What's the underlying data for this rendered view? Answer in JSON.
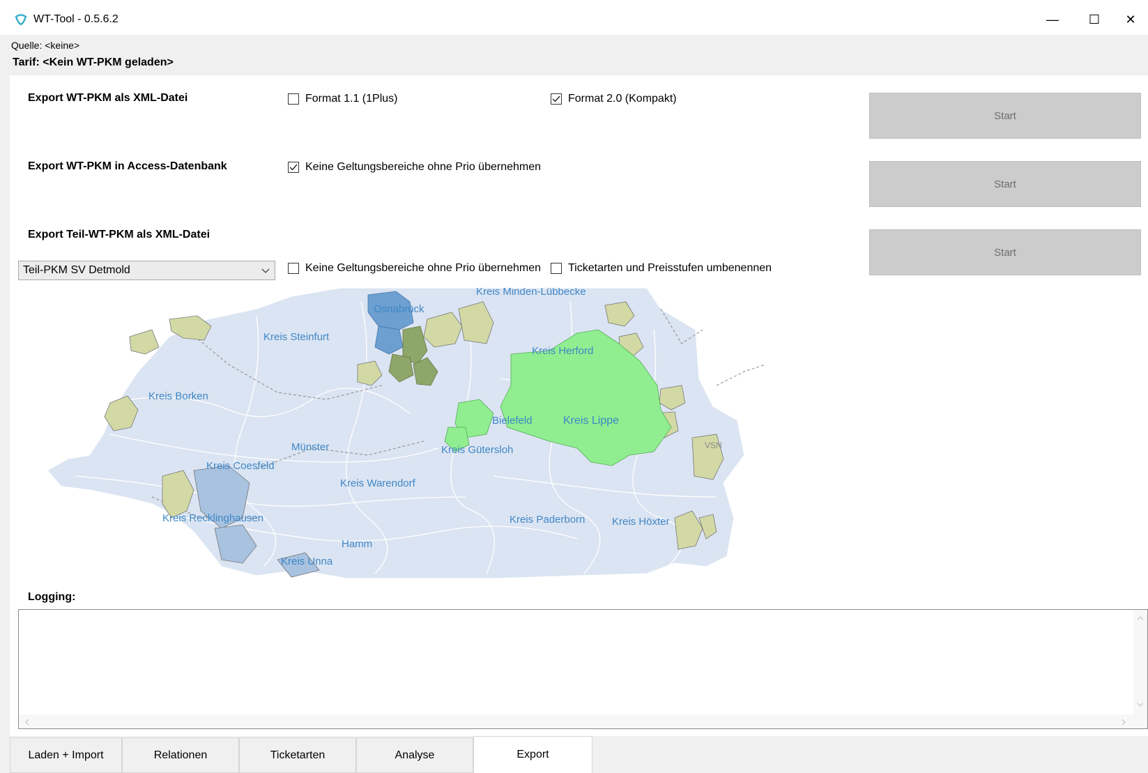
{
  "window": {
    "title": "WT-Tool - 0.5.6.2",
    "controls": {
      "minimize": "—",
      "maximize": "☐",
      "close": "✕"
    }
  },
  "info": {
    "source": "Quelle: <keine>",
    "tarif": "Tarif: <Kein WT-PKM geladen>"
  },
  "export_xml": {
    "title": "Export WT-PKM als XML-Datei",
    "format11": {
      "label": "Format 1.1 (1Plus)",
      "checked": false
    },
    "format20": {
      "label": "Format 2.0 (Kompakt)",
      "checked": true
    },
    "start": "Start"
  },
  "export_access": {
    "title": "Export WT-PKM in Access-Datenbank",
    "no_scopes": {
      "label": "Keine Geltungsbereiche ohne Prio übernehmen",
      "checked": true
    },
    "start": "Start"
  },
  "export_partial": {
    "title": "Export Teil-WT-PKM als XML-Datei",
    "selection": "Teil-PKM SV Detmold",
    "no_scopes": {
      "label": "Keine Geltungsbereiche ohne Prio übernehmen",
      "checked": false
    },
    "rename": {
      "label": "Ticketarten und Preisstufen umbenennen",
      "checked": false
    },
    "start": "Start"
  },
  "map": {
    "labels": {
      "kreis_minden": "Kreis Minden-Lübbecke",
      "osnabrueck": "Osnabrück",
      "kreis_steinfurt": "Kreis Steinfurt",
      "kreis_herford": "Kreis Herford",
      "kreis_borken": "Kreis Borken",
      "kreis_lippe": "Kreis Lippe",
      "bielefeld": "Bielefeld",
      "muenster": "Münster",
      "kreis_guetersloh": "Kreis Gütersloh",
      "kreis_coesfeld": "Kreis Coesfeld",
      "kreis_warendorf": "Kreis Warendorf",
      "kreis_recklinghausen": "Kreis Recklinghausen",
      "kreis_paderborn": "Kreis Paderborn",
      "kreis_hoexter": "Kreis Höxter",
      "hamm": "Hamm",
      "kreis_unna": "Kreis Unna",
      "vsn": "VSN"
    }
  },
  "logging": {
    "label": "Logging:"
  },
  "tabs": [
    {
      "label": "Laden + Import",
      "active": false
    },
    {
      "label": "Relationen",
      "active": false
    },
    {
      "label": "Ticketarten",
      "active": false
    },
    {
      "label": "Analyse",
      "active": false
    },
    {
      "label": "Export",
      "active": true
    }
  ]
}
